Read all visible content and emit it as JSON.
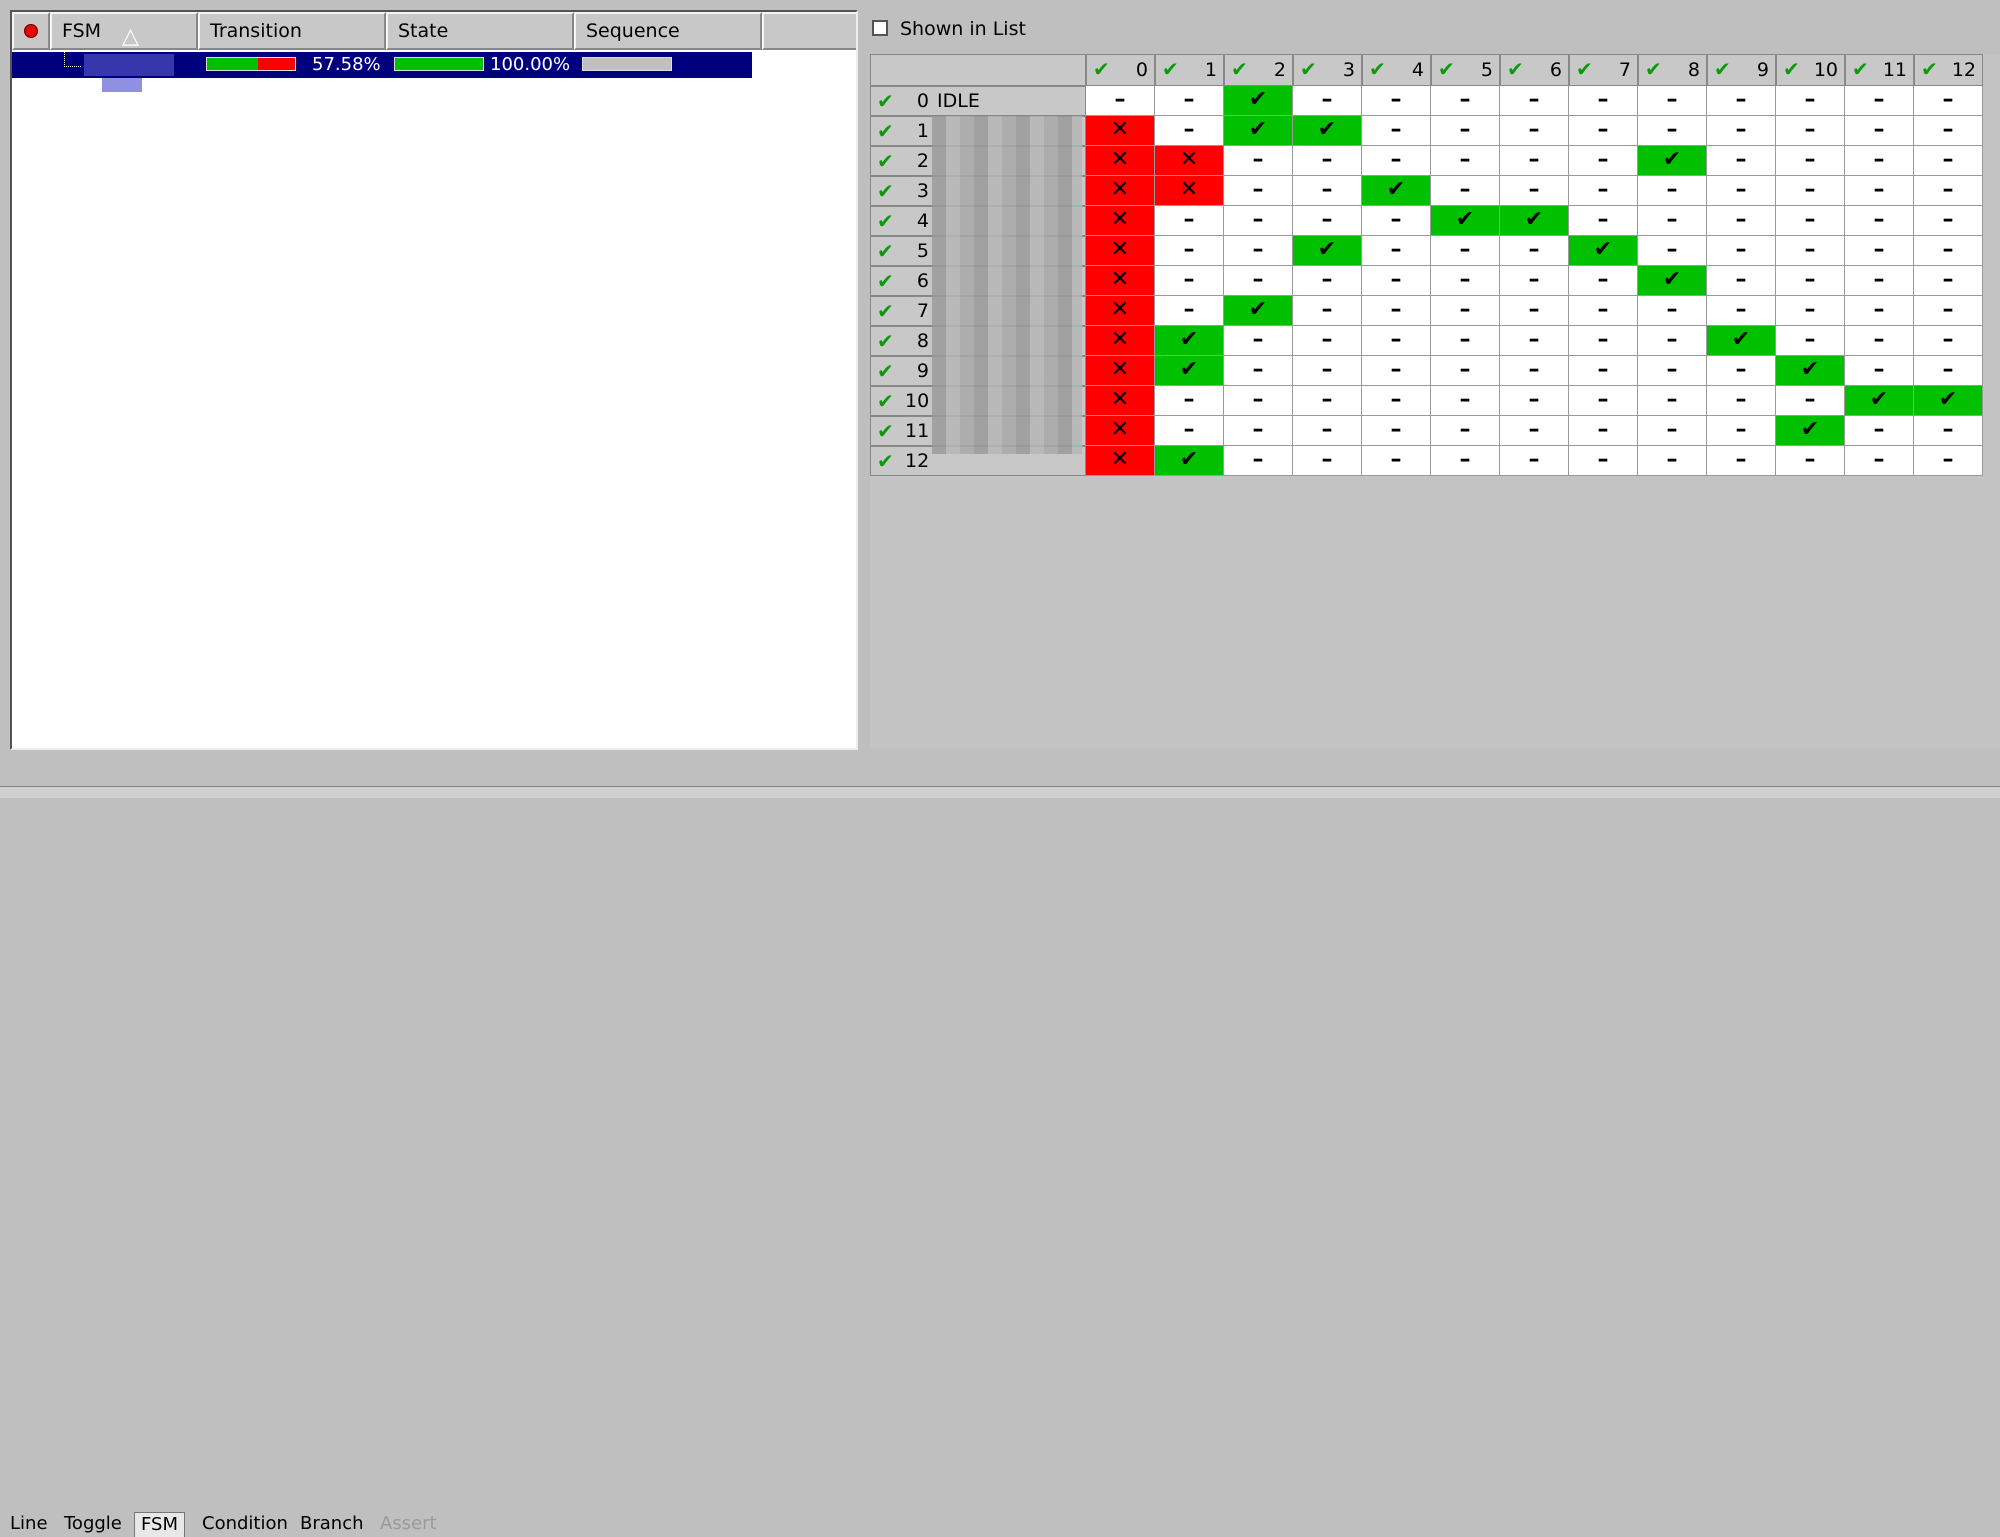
{
  "left_table": {
    "columns": [
      "FSM",
      "Transition",
      "State",
      "Sequence"
    ],
    "row": {
      "transition_pct": "57.58%",
      "state_pct": "100.00%",
      "transition_fill": 0.5758,
      "state_fill": 1.0
    }
  },
  "tabs": [
    "Line",
    "Toggle",
    "FSM",
    "Condition",
    "Branch",
    "Assert"
  ],
  "active_tab": "FSM",
  "shown_in_list_label": "Shown in List",
  "state_columns": [
    "0",
    "1",
    "2",
    "3",
    "4",
    "5",
    "6",
    "7",
    "8",
    "9",
    "10",
    "11",
    "12"
  ],
  "state_rows": [
    "0",
    "1",
    "2",
    "3",
    "4",
    "5",
    "6",
    "7",
    "8",
    "9",
    "10",
    "11",
    "12"
  ],
  "idle_label": "IDLE",
  "matrix": [
    [
      "-",
      "-",
      "G",
      "-",
      "-",
      "-",
      "-",
      "-",
      "-",
      "-",
      "-",
      "-",
      "-"
    ],
    [
      "R",
      "-",
      "G",
      "G",
      "-",
      "-",
      "-",
      "-",
      "-",
      "-",
      "-",
      "-",
      "-"
    ],
    [
      "R",
      "R",
      "-",
      "-",
      "-",
      "-",
      "-",
      "-",
      "G",
      "-",
      "-",
      "-",
      "-"
    ],
    [
      "R",
      "R",
      "-",
      "-",
      "G",
      "-",
      "-",
      "-",
      "-",
      "-",
      "-",
      "-",
      "-"
    ],
    [
      "R",
      "-",
      "-",
      "-",
      "-",
      "G",
      "G",
      "-",
      "-",
      "-",
      "-",
      "-",
      "-"
    ],
    [
      "R",
      "-",
      "-",
      "G",
      "-",
      "-",
      "-",
      "G",
      "-",
      "-",
      "-",
      "-",
      "-"
    ],
    [
      "R",
      "-",
      "-",
      "-",
      "-",
      "-",
      "-",
      "-",
      "G",
      "-",
      "-",
      "-",
      "-"
    ],
    [
      "R",
      "-",
      "G",
      "-",
      "-",
      "-",
      "-",
      "-",
      "-",
      "-",
      "-",
      "-",
      "-"
    ],
    [
      "R",
      "G",
      "-",
      "-",
      "-",
      "-",
      "-",
      "-",
      "-",
      "G",
      "-",
      "-",
      "-"
    ],
    [
      "R",
      "G",
      "-",
      "-",
      "-",
      "-",
      "-",
      "-",
      "-",
      "-",
      "G",
      "-",
      "-"
    ],
    [
      "R",
      "-",
      "-",
      "-",
      "-",
      "-",
      "-",
      "-",
      "-",
      "-",
      "-",
      "G",
      "G"
    ],
    [
      "R",
      "-",
      "-",
      "-",
      "-",
      "-",
      "-",
      "-",
      "-",
      "-",
      "G",
      "-",
      "-"
    ],
    [
      "R",
      "G",
      "-",
      "-",
      "-",
      "-",
      "-",
      "-",
      "-",
      "-",
      "-",
      "-",
      "-"
    ]
  ],
  "colors": {
    "covered": "#00c000",
    "missed": "#ff0000",
    "selection": "#00007f"
  }
}
